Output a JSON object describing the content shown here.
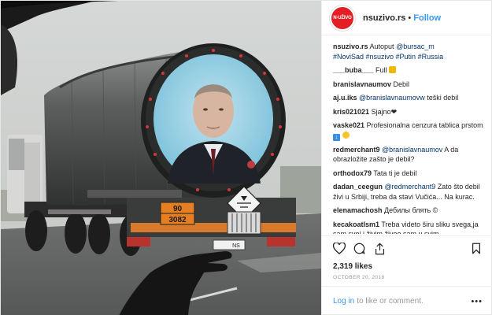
{
  "post": {
    "username": "nsuzivo.rs",
    "avatar_text": "N·UŽIVO",
    "follow_label": "Follow",
    "dot": "•",
    "likes": "2,319 likes",
    "date": "OCTOBER 20, 2018"
  },
  "photo": {
    "plate_top": "90",
    "plate_bottom": "3082",
    "rear_plate": "NS"
  },
  "caption": {
    "user": "nsuzivo.rs",
    "pre": "Autoput ",
    "mention": "@bursac_m",
    "tags": "#NoviSad #nsuzivo #Putin #Russia"
  },
  "comments": [
    {
      "user": "___buba___",
      "text": "Full"
    },
    {
      "user": "branislavnaumov",
      "text": "Debil"
    },
    {
      "user": "aj.u.iks",
      "mention": "@branislavnaumovw",
      "text": " teški debil"
    },
    {
      "user": "kris021021",
      "text": "Sjajno"
    },
    {
      "user": "vaske021",
      "text": "Profesionalna cenzura tablica prstom"
    },
    {
      "user": "redmerchant9",
      "mention": "@branislavnaumov",
      "text": " A da obrazložite zašto je debil?"
    },
    {
      "user": "orthodox79",
      "text": "Tata ti je debil"
    },
    {
      "user": "dadan_ceegun",
      "mention": "@redmerchant9",
      "text": " Zato što debil živi u Srbiji, treba da stavi Vučića... Na kurac."
    },
    {
      "user": "elenamachosh",
      "text": "Дебилы блять"
    },
    {
      "user": "kecakoatlsm1",
      "text": "Treba videto širu sliku svega,ja sam svoj i živim,živeo sam u svim"
    }
  ],
  "footer": {
    "login": "Log in",
    "rest": "to like or comment.",
    "more": "•••"
  },
  "icons": [
    "heart-icon",
    "comment-icon",
    "share-icon",
    "bookmark-icon",
    "thumbs-up-emoji",
    "heart-emoji",
    "down-arrow-emoji",
    "sweat-smile-emoji",
    "copyright-emoji"
  ]
}
